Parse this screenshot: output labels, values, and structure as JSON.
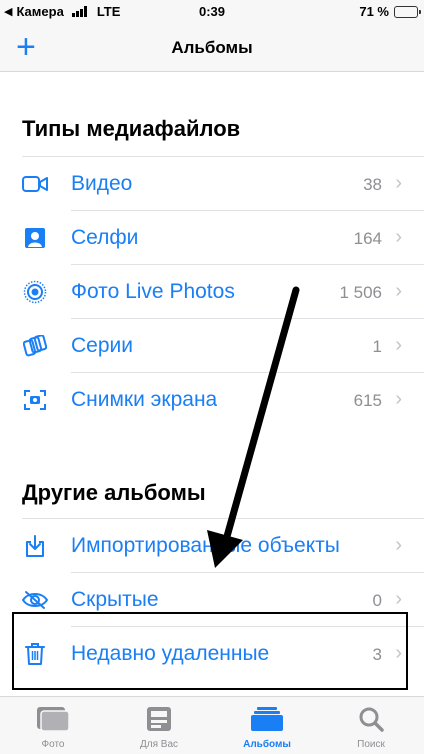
{
  "status_bar": {
    "carrier_back": "Камера",
    "network": "LTE",
    "time": "0:39",
    "battery_text": "71 %",
    "battery_level": 0.71
  },
  "nav": {
    "add_label": "+",
    "title": "Альбомы"
  },
  "media_types": {
    "title": "Типы медиафайлов",
    "items": [
      {
        "label": "Видео",
        "count": "38",
        "icon": "video-icon"
      },
      {
        "label": "Селфи",
        "count": "164",
        "icon": "selfie-icon"
      },
      {
        "label": "Фото Live Photos",
        "count": "1 506",
        "icon": "live-photos-icon"
      },
      {
        "label": "Серии",
        "count": "1",
        "icon": "bursts-icon"
      },
      {
        "label": "Снимки экрана",
        "count": "615",
        "icon": "screenshot-icon"
      }
    ]
  },
  "other_albums": {
    "title": "Другие альбомы",
    "items": [
      {
        "label": "Импортированные объекты",
        "count": "",
        "icon": "import-icon"
      },
      {
        "label": "Скрытые",
        "count": "0",
        "icon": "hidden-icon"
      },
      {
        "label": "Недавно удаленные",
        "count": "3",
        "icon": "trash-icon"
      }
    ]
  },
  "tabs": [
    {
      "label": "Фото",
      "icon": "photos-tab-icon",
      "active": false
    },
    {
      "label": "Для Вас",
      "icon": "for-you-tab-icon",
      "active": false
    },
    {
      "label": "Альбомы",
      "icon": "albums-tab-icon",
      "active": true
    },
    {
      "label": "Поиск",
      "icon": "search-tab-icon",
      "active": false
    }
  ],
  "colors": {
    "accent": "#1a7ff5",
    "secondary_text": "#8e8e93",
    "battery": "#f5c518"
  }
}
